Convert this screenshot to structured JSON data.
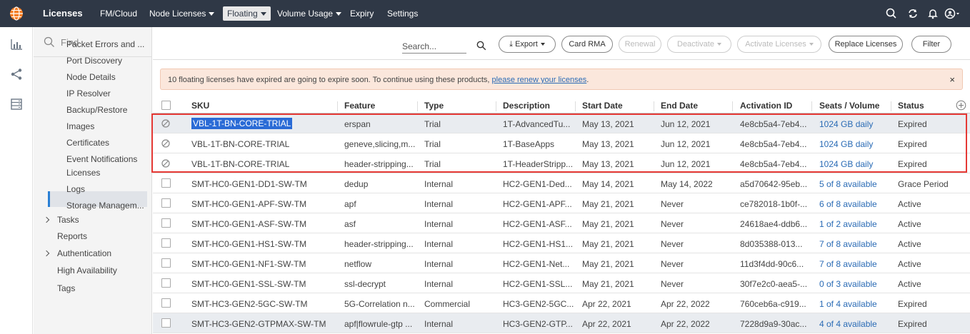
{
  "topnav": {
    "logo_icon": "globe-logo-icon",
    "items": [
      {
        "label": "Licenses",
        "bold": true
      },
      {
        "label": "FM/Cloud"
      },
      {
        "label": "Node Licenses",
        "dropdown": true
      },
      {
        "label": "Floating",
        "dropdown": true,
        "active": true
      },
      {
        "label": "Volume Usage",
        "dropdown": true
      },
      {
        "label": "Expiry"
      },
      {
        "label": "Settings"
      }
    ],
    "right_icons": [
      "search-icon",
      "refresh-icon",
      "bell-icon",
      "user-icon"
    ],
    "bg_color": "#2f3846"
  },
  "rail_icons": [
    "chart-icon",
    "share-icon",
    "storage-icon"
  ],
  "sidebar": {
    "find_placeholder": "Find",
    "items": [
      {
        "label": "Packet Errors and ..."
      },
      {
        "label": "Port Discovery"
      },
      {
        "label": "Node Details"
      },
      {
        "label": "IP Resolver"
      },
      {
        "label": "Backup/Restore"
      },
      {
        "label": "Images"
      },
      {
        "label": "Certificates"
      },
      {
        "label": "Event Notifications"
      },
      {
        "label": "Licenses",
        "active": true
      },
      {
        "label": "Logs"
      },
      {
        "label": "Storage Managem..."
      },
      {
        "label": "Tasks",
        "expandable": true
      },
      {
        "label": "Reports"
      },
      {
        "label": "Authentication",
        "expandable": true
      },
      {
        "label": "High Availability"
      },
      {
        "label": "Tags"
      }
    ]
  },
  "toolbar": {
    "search_placeholder": "Search...",
    "buttons": [
      {
        "label": "Export",
        "dropdown": true,
        "enabled": true
      },
      {
        "label": "Card RMA",
        "enabled": true
      },
      {
        "label": "Renewal",
        "enabled": false
      },
      {
        "label": "Deactivate",
        "dropdown": true,
        "enabled": false
      },
      {
        "label": "Activate Licenses",
        "dropdown": true,
        "enabled": false
      },
      {
        "label": "Replace Licenses",
        "enabled": true
      },
      {
        "label": "Filter",
        "enabled": true
      }
    ]
  },
  "alert": {
    "text": "10 floating licenses have expired are going to expire soon. To continue using these products, ",
    "link": "please renew your licenses",
    "suffix": ".",
    "close": "×"
  },
  "table": {
    "columns": [
      "SKU",
      "Feature",
      "Type",
      "Description",
      "Start Date",
      "End Date",
      "Activation ID",
      "Seats / Volume",
      "Status"
    ],
    "rows": [
      {
        "sku": "VBL-1T-BN-CORE-TRIAL",
        "feature": "erspan",
        "type": "Trial",
        "description": "1T-AdvancedTu...",
        "start": "May 13, 2021",
        "end": "Jun 12, 2021",
        "activation": "4e8cb5a4-7eb4...",
        "seats": "1024 GB daily",
        "status": "Expired",
        "disabled": true,
        "selected": true
      },
      {
        "sku": "VBL-1T-BN-CORE-TRIAL",
        "feature": "geneve,slicing,m...",
        "type": "Trial",
        "description": "1T-BaseApps",
        "start": "May 13, 2021",
        "end": "Jun 12, 2021",
        "activation": "4e8cb5a4-7eb4...",
        "seats": "1024 GB daily",
        "status": "Expired",
        "disabled": true
      },
      {
        "sku": "VBL-1T-BN-CORE-TRIAL",
        "feature": "header-stripping...",
        "type": "Trial",
        "description": "1T-HeaderStripp...",
        "start": "May 13, 2021",
        "end": "Jun 12, 2021",
        "activation": "4e8cb5a4-7eb4...",
        "seats": "1024 GB daily",
        "status": "Expired",
        "disabled": true
      },
      {
        "sku": "SMT-HC0-GEN1-DD1-SW-TM",
        "feature": "dedup",
        "type": "Internal",
        "description": "HC2-GEN1-Ded...",
        "start": "May 14, 2021",
        "end": "May 14, 2022",
        "activation": "a5d70642-95eb...",
        "seats": "5 of 8 available",
        "status": "Grace Period"
      },
      {
        "sku": "SMT-HC0-GEN1-APF-SW-TM",
        "feature": "apf",
        "type": "Internal",
        "description": "HC2-GEN1-APF...",
        "start": "May 21, 2021",
        "end": "Never",
        "activation": "ce782018-1b0f-...",
        "seats": "6 of 8 available",
        "status": "Active"
      },
      {
        "sku": "SMT-HC0-GEN1-ASF-SW-TM",
        "feature": "asf",
        "type": "Internal",
        "description": "HC2-GEN1-ASF...",
        "start": "May 21, 2021",
        "end": "Never",
        "activation": "24618ae4-ddb6...",
        "seats": "1 of 2 available",
        "status": "Active"
      },
      {
        "sku": "SMT-HC0-GEN1-HS1-SW-TM",
        "feature": "header-stripping...",
        "type": "Internal",
        "description": "HC2-GEN1-HS1...",
        "start": "May 21, 2021",
        "end": "Never",
        "activation": "8d035388-013...",
        "seats": "7 of 8 available",
        "status": "Active"
      },
      {
        "sku": "SMT-HC0-GEN1-NF1-SW-TM",
        "feature": "netflow",
        "type": "Internal",
        "description": "HC2-GEN1-Net...",
        "start": "May 21, 2021",
        "end": "Never",
        "activation": "11d3f4dd-90c6...",
        "seats": "7 of 8 available",
        "status": "Active"
      },
      {
        "sku": "SMT-HC0-GEN1-SSL-SW-TM",
        "feature": "ssl-decrypt",
        "type": "Internal",
        "description": "HC2-GEN1-SSL...",
        "start": "May 21, 2021",
        "end": "Never",
        "activation": "30f7e2c0-aea5-...",
        "seats": "0 of 3 available",
        "status": "Active"
      },
      {
        "sku": "SMT-HC3-GEN2-5GC-SW-TM",
        "feature": "5G-Correlation n...",
        "type": "Commercial",
        "description": "HC3-GEN2-5GC...",
        "start": "Apr 22, 2021",
        "end": "Apr 22, 2022",
        "activation": "760ceb6a-c919...",
        "seats": "1 of 4 available",
        "status": "Expired"
      },
      {
        "sku": "SMT-HC3-GEN2-GTPMAX-SW-TM",
        "feature": "apf|flowrule-gtp ...",
        "type": "Internal",
        "description": "HC3-GEN2-GTP...",
        "start": "Apr 22, 2021",
        "end": "Apr 22, 2022",
        "activation": "7228d9a9-30ac...",
        "seats": "4 of 4 available",
        "status": "Expired"
      }
    ]
  },
  "colors": {
    "accent": "#2a7fd4",
    "link": "#2a6bb5",
    "highlight_box": "#e53935",
    "alert_bg": "#fbe7dc"
  }
}
